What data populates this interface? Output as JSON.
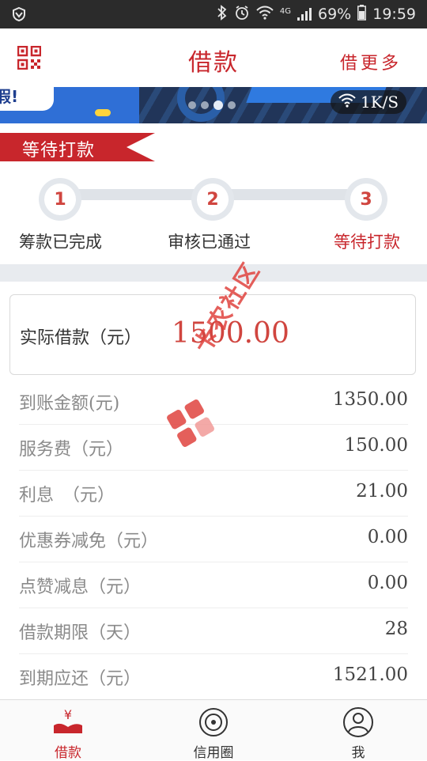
{
  "status_bar": {
    "battery": "69%",
    "time": "19:59",
    "network": "4G"
  },
  "header": {
    "title": "借款",
    "more_label": "借更多"
  },
  "banner": {
    "text_left": "放假!",
    "speed": "1K/S"
  },
  "status_ribbon": {
    "label": "等待打款"
  },
  "steps": [
    {
      "num": "1",
      "label": "筹款已完成"
    },
    {
      "num": "2",
      "label": "审核已通过"
    },
    {
      "num": "3",
      "label": "等待打款"
    }
  ],
  "actual_loan": {
    "label": "实际借款（元）",
    "value": "1500.00"
  },
  "details": [
    {
      "label": "到账金额(元)",
      "value": "1350.00"
    },
    {
      "label": "服务费（元）",
      "value": "150.00"
    },
    {
      "label": "利息　（元）",
      "value": "21.00"
    },
    {
      "label": "优惠券减免（元）",
      "value": "0.00"
    },
    {
      "label": "点赞减息（元）",
      "value": "0.00"
    },
    {
      "label": "借款期限（天）",
      "value": "28"
    },
    {
      "label": "到期应还（元）",
      "value": "1521.00"
    }
  ],
  "watermark": {
    "text": "卡农社区"
  },
  "bottom_nav": [
    {
      "label": "借款",
      "icon": "loan-icon",
      "active": true
    },
    {
      "label": "信用圈",
      "icon": "credit-circle-icon",
      "active": false
    },
    {
      "label": "我",
      "icon": "user-icon",
      "active": false
    }
  ],
  "colors": {
    "accent": "#c8262c",
    "amount": "#d0453f",
    "status_bar": "#2b2b2b"
  }
}
